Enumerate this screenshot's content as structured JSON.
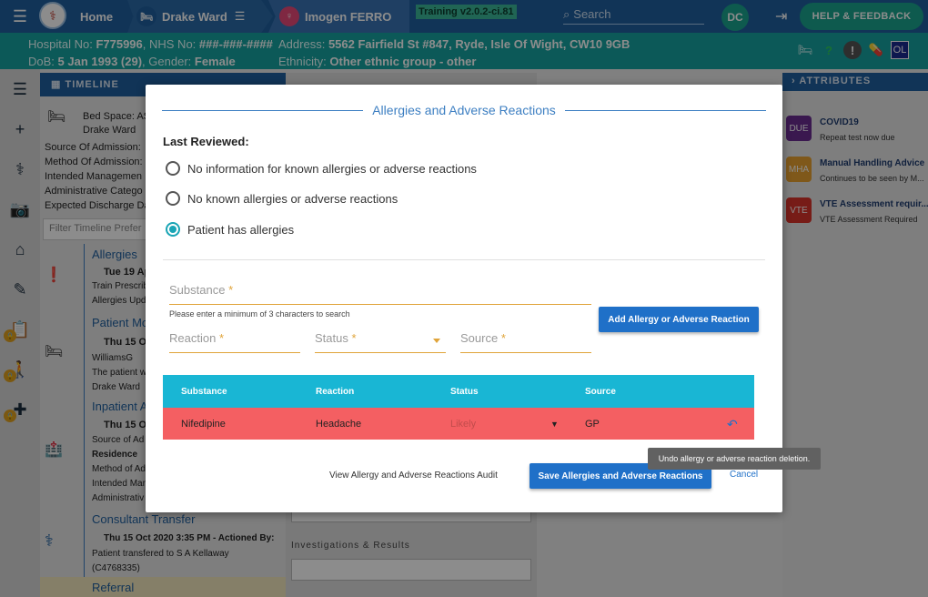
{
  "topbar": {
    "home_label": "Home",
    "ward_label": "Drake Ward",
    "patient_label": "Imogen FERRO",
    "training_badge": "Training v2.0.2-ci.81",
    "search_placeholder": "Search",
    "user_initials": "DC",
    "help_label": "HELP & FEEDBACK"
  },
  "patient_banner": {
    "hospital_no_label": "Hospital No:",
    "hospital_no": "F775996",
    "nhs_no_label": "NHS No:",
    "nhs_no": "###-###-####",
    "dob_label": "DoB:",
    "dob": "5 Jan 1993 (29)",
    "gender_label": "Gender:",
    "gender": "Female",
    "address_label": "Address:",
    "address": "5562 Fairfield St #847, Ryde, Isle Of Wight, CW10 9GB",
    "ethnicity_label": "Ethnicity:",
    "ethnicity": "Other ethnic group - other",
    "ol_badge": "OL"
  },
  "panels": {
    "timeline_title": "TIMELINE",
    "attributes_title": "ATTRIBUTES"
  },
  "timeline": {
    "bed_space_label": "Bed Space: AS",
    "ward": "Drake Ward",
    "rows": [
      "Source Of Admission:",
      "Method Of Admission:",
      "Intended Managemen",
      "Administrative Catego",
      "Expected Discharge Da"
    ],
    "filter_placeholder": "Filter Timeline Prefer",
    "entries": [
      {
        "title": "Allergies",
        "date": "Tue 19 Apr",
        "lines": [
          "Train Prescrib",
          "Allergies Upd"
        ]
      },
      {
        "title": "Patient Mo",
        "date": "Thu 15 Oct",
        "lines": [
          "WilliamsG",
          "The patient w",
          "Drake Ward"
        ]
      },
      {
        "title": "Inpatient A",
        "date": "Thu 15 Oct",
        "lines": [
          "Source of Ad",
          "Residence",
          "Method of Ad",
          "Intended Man",
          "Administrativ"
        ]
      },
      {
        "title": "Consultant Transfer",
        "date": "Thu 15 Oct 2020 3:35 PM - Actioned By:",
        "lines": [
          "Patient transfered to S A Kellaway",
          "(C4768335)"
        ]
      },
      {
        "title": "Referral",
        "date": "",
        "lines": []
      }
    ]
  },
  "middle": {
    "investigations_label": "Investigations & Results"
  },
  "attributes": [
    {
      "icon": "DUE",
      "title": "COVID19",
      "subtitle": "Repeat test now due",
      "color": "#6a2c91"
    },
    {
      "icon": "MHA",
      "title": "Manual Handling Advice",
      "subtitle": "Continues to be seen by M...",
      "color": "#e8a030"
    },
    {
      "icon": "VTE",
      "title": "VTE Assessment requir...",
      "subtitle": "VTE Assessment Required",
      "color": "#d9342b"
    }
  ],
  "modal": {
    "title": "Allergies and Adverse Reactions",
    "last_reviewed_label": "Last Reviewed:",
    "options": [
      "No information for known allergies or adverse reactions",
      "No known allergies or adverse reactions",
      "Patient has allergies"
    ],
    "selected_option": 2,
    "substance_placeholder": "Substance",
    "hint": "Please enter a minimum of 3 characters to search",
    "add_button": "Add Allergy or Adverse Reaction",
    "reaction_placeholder": "Reaction",
    "status_placeholder": "Status",
    "source_placeholder": "Source",
    "required_mark": "*",
    "table": {
      "headers": [
        "Substance",
        "Reaction",
        "Status",
        "Source"
      ],
      "rows": [
        {
          "substance": "Nifedipine",
          "reaction": "Headache",
          "status": "Likely",
          "source": "GP"
        }
      ]
    },
    "audit_link": "View Allergy and Adverse Reactions Audit",
    "save_button": "Save Allergies and Adverse Reactions",
    "cancel_button": "Cancel",
    "tooltip": "Undo allergy or adverse reaction deletion."
  },
  "colors": {
    "topbar": "#1f5f9e",
    "patient_banner": "#16a3a0",
    "accent": "#1f70c8",
    "table_header": "#19b6d4",
    "deleted_row": "#f45f62"
  }
}
